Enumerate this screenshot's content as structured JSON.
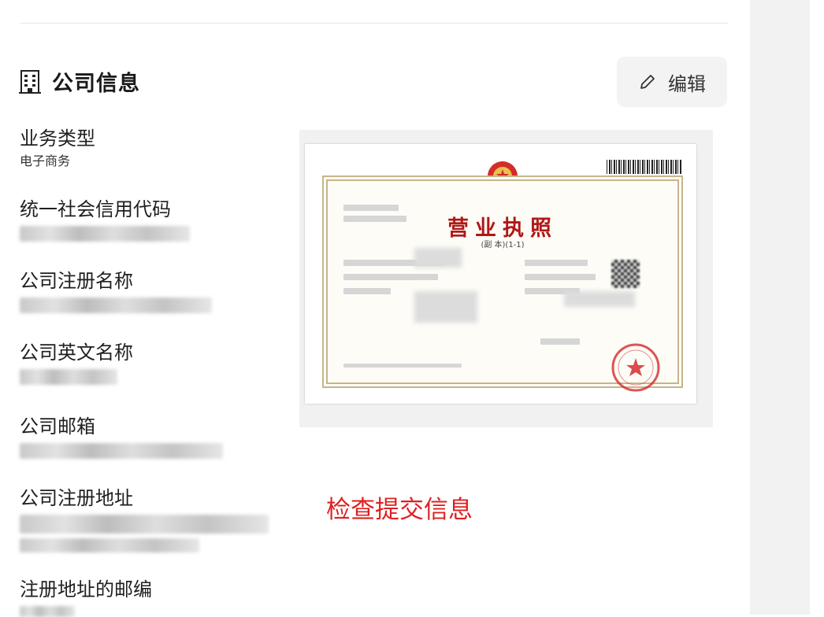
{
  "header": {
    "title": "公司信息",
    "icon": "building-icon"
  },
  "edit_button": {
    "label": "编辑",
    "icon": "pencil-icon"
  },
  "fields": {
    "business_type": {
      "label": "业务类型",
      "value": "电子商务"
    },
    "credit_code": {
      "label": "统一社会信用代码"
    },
    "registered_name": {
      "label": "公司注册名称"
    },
    "english_name": {
      "label": "公司英文名称"
    },
    "email": {
      "label": "公司邮箱"
    },
    "registered_address": {
      "label": "公司注册地址"
    },
    "postcode": {
      "label": "注册地址的邮编"
    }
  },
  "license": {
    "title": "营业执照",
    "subtitle": "(副 本)(1-1)"
  },
  "annotation": {
    "text": "检查提交信息",
    "color": "#e02020"
  },
  "colors": {
    "divider": "#e6e6e6",
    "panel_bg": "#f2f2f2",
    "button_bg": "#f3f3f3"
  }
}
